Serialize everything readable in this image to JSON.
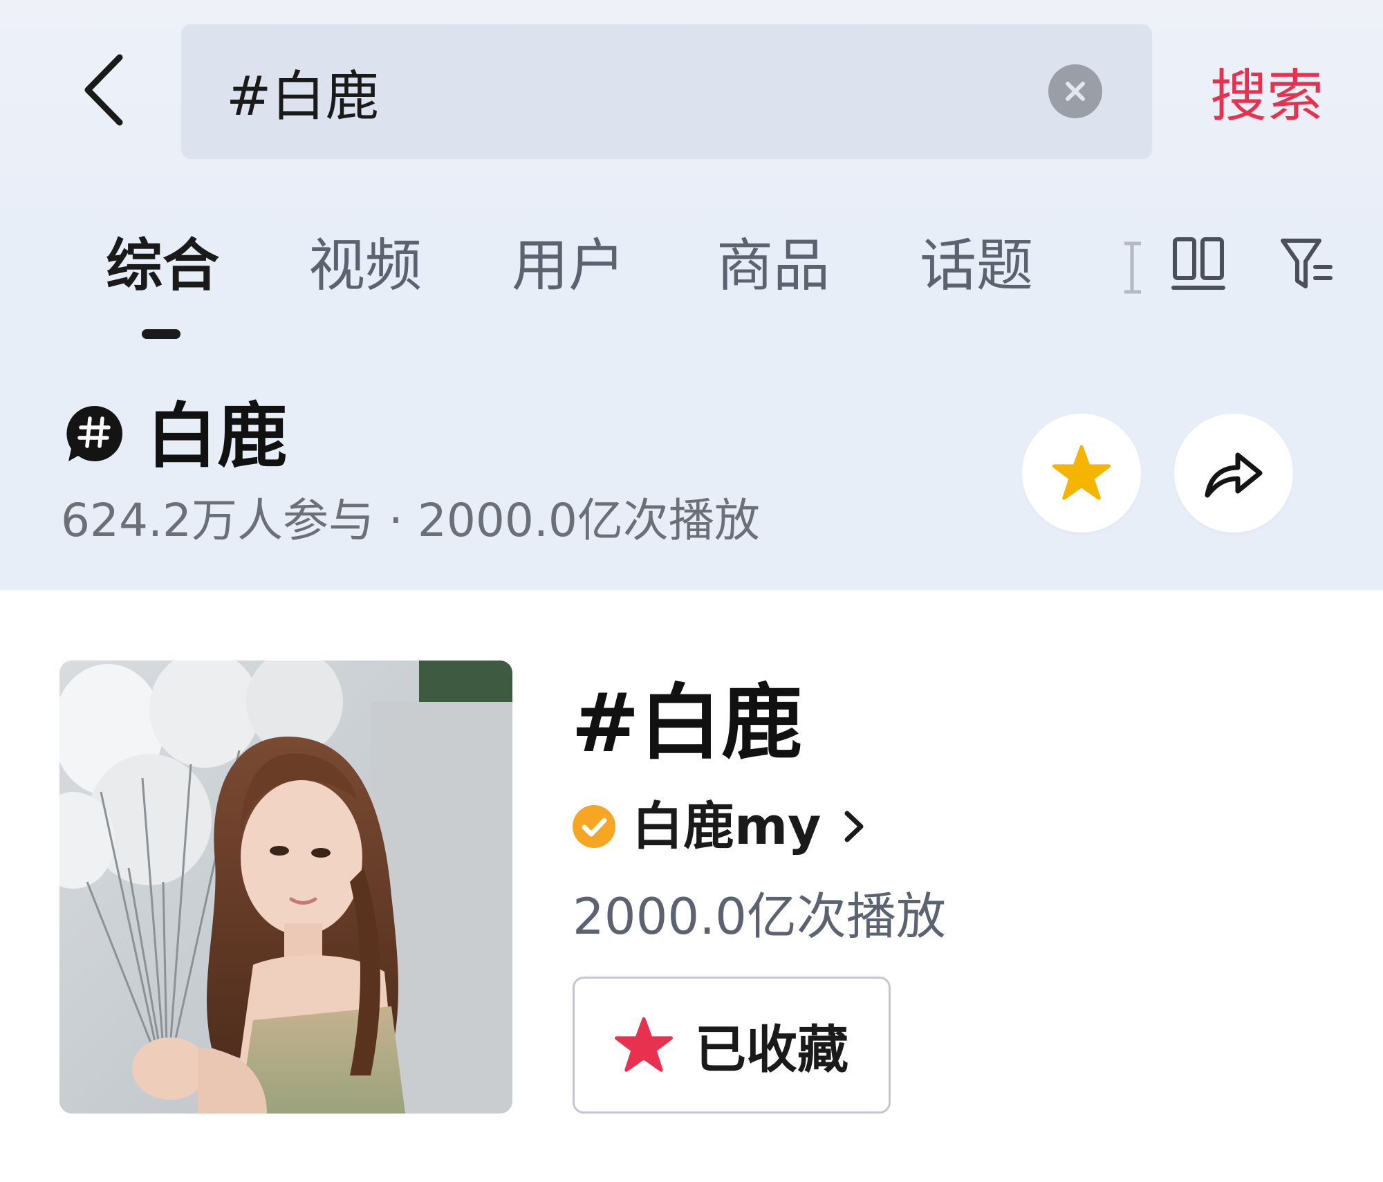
{
  "search": {
    "query": "#白鹿",
    "submit_label": "搜索"
  },
  "tabs": [
    {
      "label": "综合",
      "active": true
    },
    {
      "label": "视频",
      "active": false
    },
    {
      "label": "用户",
      "active": false
    },
    {
      "label": "商品",
      "active": false
    },
    {
      "label": "话题",
      "active": false
    }
  ],
  "topic": {
    "title": "白鹿",
    "stats": "624.2万人参与 · 2000.0亿次播放"
  },
  "card": {
    "title": "#白鹿",
    "creator": "白鹿my",
    "plays": "2000.0亿次播放",
    "collected_label": "已收藏"
  },
  "icons": {
    "back": "chevron-left-icon",
    "clear": "close-circle-icon",
    "layout": "dual-column-icon",
    "filter": "filter-icon",
    "topic": "hashtag-bubble-icon",
    "favorite": "star-icon",
    "share": "share-arrow-icon",
    "verified": "verified-check-icon"
  },
  "colors": {
    "accent_red": "#e8314f",
    "star_yellow": "#f5b400",
    "verified_orange": "#f6a623",
    "header_bg": "#e8eef8",
    "search_bg": "#dde3ee"
  }
}
